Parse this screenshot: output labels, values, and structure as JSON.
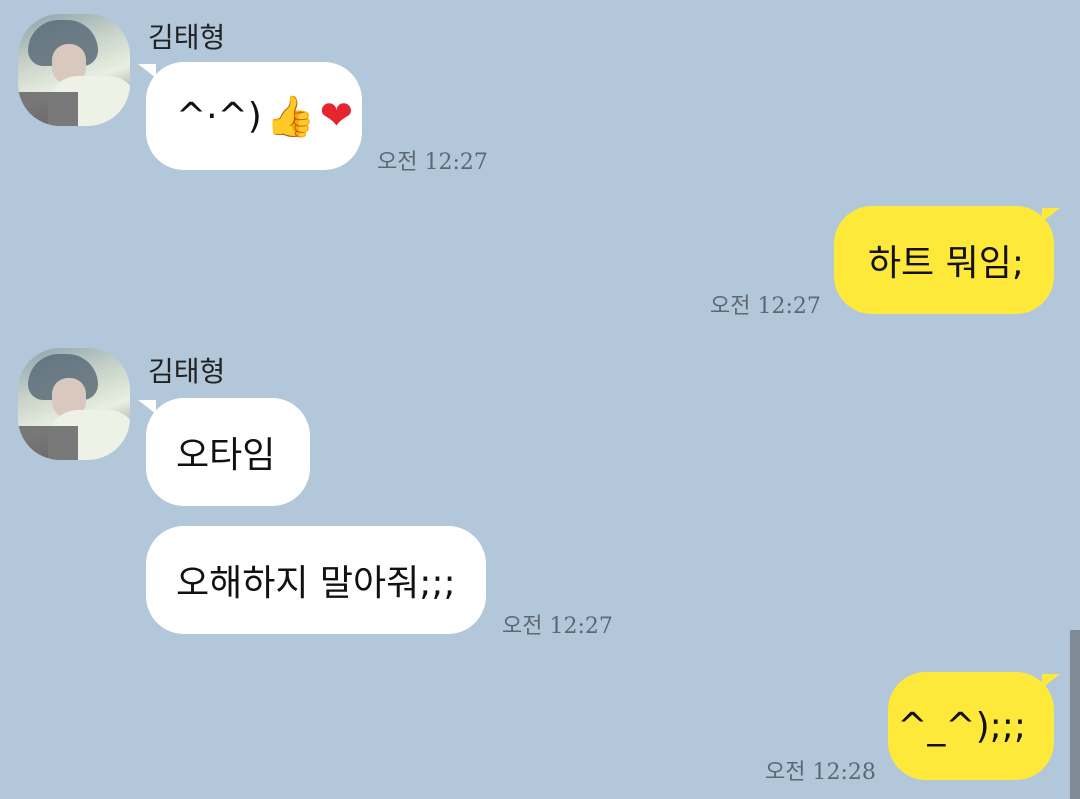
{
  "messages": [
    {
      "type": "incoming",
      "sender": "김태형",
      "text": "^·^)",
      "emoji": [
        "👍",
        "❤"
      ],
      "time": "오전 12:27"
    },
    {
      "type": "outgoing",
      "text": "하트 뭐임;",
      "time": "오전 12:27"
    },
    {
      "type": "incoming",
      "sender": "김태형",
      "text": "오타임"
    },
    {
      "type": "incoming",
      "text": "오해하지 말아줘;;;",
      "time": "오전 12:27"
    },
    {
      "type": "outgoing",
      "text": "^_^);;;",
      "time": "오전 12:28"
    }
  ],
  "colors": {
    "background": "#b2c7da",
    "incoming_bubble": "#ffffff",
    "outgoing_bubble": "#fee93b"
  }
}
